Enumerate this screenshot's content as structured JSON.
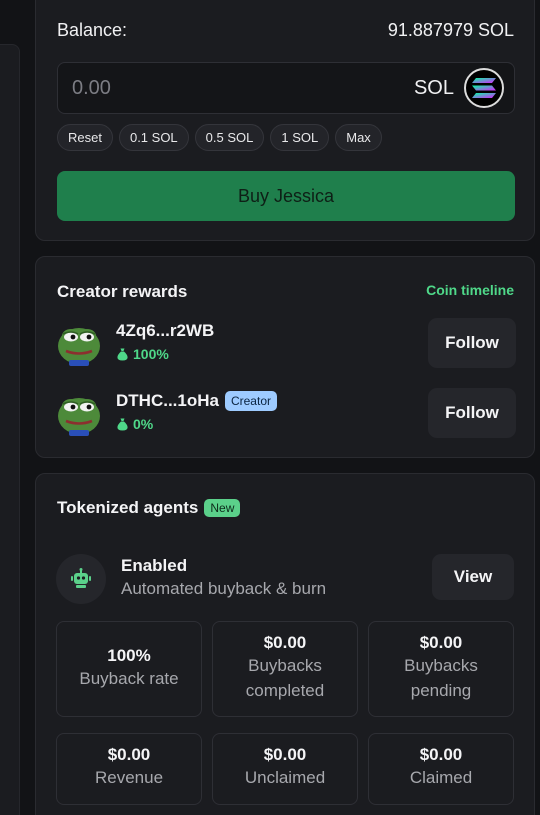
{
  "trade": {
    "balance_label": "Balance:",
    "balance_value": "91.887979 SOL",
    "amount_placeholder": "0.00",
    "currency": "SOL",
    "currency_icon": "solana-logo-icon",
    "quick_amounts": [
      "Reset",
      "0.1 SOL",
      "0.5 SOL",
      "1 SOL",
      "Max"
    ],
    "buy_label": "Buy Jessica",
    "buy_color": "#1f7f4c"
  },
  "rewards": {
    "title": "Creator rewards",
    "timeline_link": "Coin timeline",
    "creators": [
      {
        "address": "4Zq6...r2WB",
        "share": "100%",
        "badge": "",
        "follow_label": "Follow",
        "avatar": "pepe-avatar"
      },
      {
        "address": "DTHC...1oHa",
        "share": "0%",
        "badge": "Creator",
        "follow_label": "Follow",
        "avatar": "pepe-avatar"
      }
    ]
  },
  "agents": {
    "title": "Tokenized agents",
    "new_badge": "New",
    "status_title": "Enabled",
    "status_subtitle": "Automated buyback & burn",
    "view_label": "View",
    "stats": [
      {
        "value": "100%",
        "label": "Buyback rate"
      },
      {
        "value": "$0.00",
        "label_lines": [
          "Buybacks",
          "completed"
        ]
      },
      {
        "value": "$0.00",
        "label_lines": [
          "Buybacks",
          "pending"
        ]
      },
      {
        "value": "$0.00",
        "label": "Revenue"
      },
      {
        "value": "$0.00",
        "label": "Unclaimed"
      },
      {
        "value": "$0.00",
        "label": "Claimed"
      }
    ]
  },
  "colors": {
    "accent_green": "#4fd889",
    "creator_badge": "#9ecbff",
    "background": "#121316",
    "card": "#1b1c20"
  }
}
